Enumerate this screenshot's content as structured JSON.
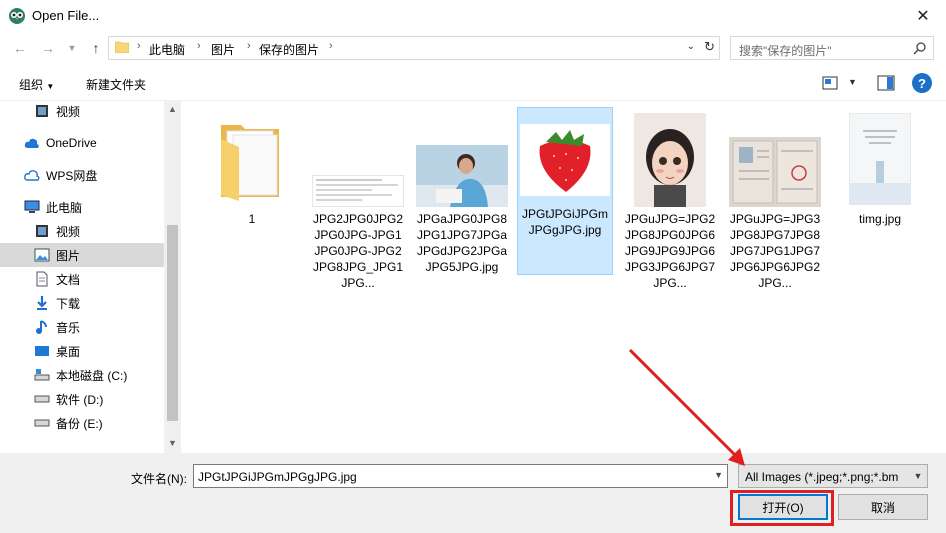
{
  "window": {
    "title": "Open File..."
  },
  "address": {
    "segments": [
      "此电脑",
      "图片",
      "保存的图片"
    ],
    "search_placeholder": "搜索\"保存的图片\""
  },
  "toolbar": {
    "organize": "组织",
    "new_folder": "新建文件夹"
  },
  "nav": {
    "items": [
      {
        "label": "视频",
        "icon": "video-icon"
      },
      {
        "label": "OneDrive",
        "icon": "cloud-icon"
      },
      {
        "label": "WPS网盘",
        "icon": "wps-cloud-icon"
      },
      {
        "label": "此电脑",
        "icon": "computer-icon"
      },
      {
        "label": "视频",
        "icon": "video-icon"
      },
      {
        "label": "图片",
        "icon": "pictures-icon",
        "selected": true
      },
      {
        "label": "文档",
        "icon": "document-icon"
      },
      {
        "label": "下载",
        "icon": "download-icon"
      },
      {
        "label": "音乐",
        "icon": "music-icon"
      },
      {
        "label": "桌面",
        "icon": "desktop-icon"
      },
      {
        "label": "本地磁盘 (C:)",
        "icon": "drive-c-icon"
      },
      {
        "label": "软件 (D:)",
        "icon": "drive-icon"
      },
      {
        "label": "备份 (E:)",
        "icon": "drive-icon"
      }
    ]
  },
  "files": [
    {
      "name": "1",
      "type": "folder"
    },
    {
      "name": "JPG2JPG0JPG2JPG0JPG-JPG1JPG0JPG-JPG2JPG8JPG_JPG1JPG...",
      "type": "document-image"
    },
    {
      "name": "JPGaJPG0JPG8JPG1JPG7JPGaJPGdJPG2JPGaJPG5JPG.jpg",
      "type": "photo-person"
    },
    {
      "name": "JPGtJPGiJPGmJPGgJPG.jpg",
      "type": "strawberry",
      "selected": true
    },
    {
      "name": "JPGuJPG=JPG2JPG8JPG0JPG6JPG9JPG9JPG6JPG3JPG6JPG7JPG...",
      "type": "girl-drawing"
    },
    {
      "name": "JPGuJPG=JPG3JPG8JPG7JPG8JPG7JPG1JPG7JPG6JPG6JPG2JPG...",
      "type": "certificate"
    },
    {
      "name": "timg.jpg",
      "type": "poster"
    }
  ],
  "bottom": {
    "filename_label": "文件名(N):",
    "filename_value": "JPGtJPGiJPGmJPGgJPG.jpg",
    "filter_value": "All Images (*.jpeg;*.png;*.bm",
    "open_label": "打开(O)",
    "cancel_label": "取消"
  },
  "colors": {
    "accent": "#0078d7",
    "selection": "#cce8ff",
    "annotation": "#e02020"
  }
}
